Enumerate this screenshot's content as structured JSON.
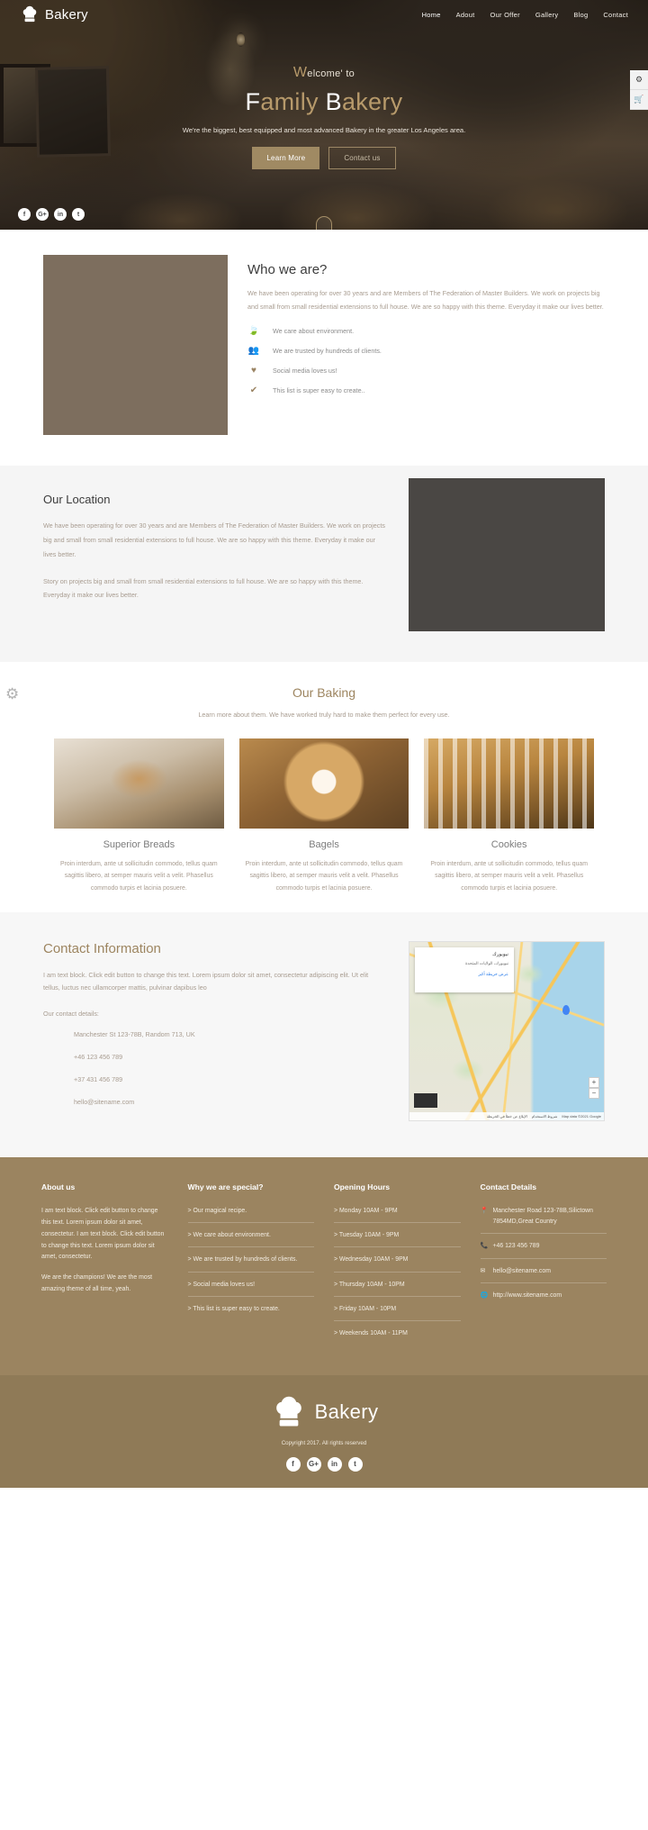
{
  "brand": {
    "name": "Bakery",
    "icon": "chef-hat-icon"
  },
  "nav": {
    "items": [
      {
        "label": "Home",
        "active": true
      },
      {
        "label": "Adout",
        "active": false
      },
      {
        "label": "Our Offer",
        "active": false
      },
      {
        "label": "Gallery",
        "active": false
      },
      {
        "label": "Blog",
        "active": false
      },
      {
        "label": "Contact",
        "active": false
      }
    ]
  },
  "side_tools": [
    {
      "icon": "gear-settings-icon",
      "glyph": "⚙"
    },
    {
      "icon": "shopping-cart-icon",
      "glyph": "🛒"
    }
  ],
  "hero": {
    "welcome_first": "W",
    "welcome_rest": "elcome' to",
    "title_pre": "F",
    "title_mid": "amily ",
    "title_b": "B",
    "title_end": "akery",
    "subtitle": "We're the biggest, best equipped and most advanced Bakery in the greater Los Angeles area.",
    "btn_primary": "Learn More",
    "btn_secondary": "Contact us",
    "social": [
      {
        "name": "facebook-icon",
        "glyph": "f"
      },
      {
        "name": "google-plus-icon",
        "glyph": "G+"
      },
      {
        "name": "linkedin-icon",
        "glyph": "in"
      },
      {
        "name": "twitter-icon",
        "glyph": "t"
      }
    ]
  },
  "who": {
    "title": "Who we are?",
    "paragraph": "We have been operating for over 30 years and are Members of The Federation of Master Builders. We work on projects big and small from small residential extensions to full house. We are so happy with this theme. Everyday it make our lives better.",
    "features": [
      {
        "icon": "leaf-icon",
        "glyph": "🍃",
        "text": "We care about environment."
      },
      {
        "icon": "users-group-icon",
        "glyph": "👥",
        "text": "We are trusted by hundreds of clients."
      },
      {
        "icon": "heart-icon",
        "glyph": "♥",
        "text": "Social media loves us!"
      },
      {
        "icon": "check-icon",
        "glyph": "✔",
        "text": "This list is super easy to create.."
      }
    ]
  },
  "location": {
    "title": "Our Location",
    "paragraph1": "We have been operating for over 30 years and are Members of The Federation of Master Builders. We work on projects big and small from small residential extensions to full house. We are so happy with this theme. Everyday it make our lives better.",
    "paragraph2": "Story on projects big and small from small residential extensions to full house. We are so happy with this theme. Everyday it make our lives better."
  },
  "baking": {
    "title": "Our Baking",
    "subtitle": "Learn more about them. We have worked truly hard to make them perfect for every use.",
    "gear_icon": "gear-icon",
    "cards": [
      {
        "title": "Superior Breads",
        "desc": "Proin interdum, ante ut sollicitudin commodo, tellus quam sagittis libero, at semper mauris velit a velit. Phasellus commodo turpis et lacinia posuere."
      },
      {
        "title": "Bagels",
        "desc": "Proin interdum, ante ut sollicitudin commodo, tellus quam sagittis libero, at semper mauris velit a velit. Phasellus commodo turpis et lacinia posuere."
      },
      {
        "title": "Cookies",
        "desc": "Proin interdum, ante ut sollicitudin commodo, tellus quam sagittis libero, at semper mauris velit a velit. Phasellus commodo turpis et lacinia posuere."
      }
    ]
  },
  "contact": {
    "title": "Contact Information",
    "paragraph": "I am text block. Click edit button to change this text. Lorem ipsum dolor sit amet, consectetur adipiscing elit. Ut elit tellus, luctus nec ullamcorper mattis, pulvinar dapibus leo",
    "details_label": "Our contact details:",
    "details": [
      "Manchester St 123-78B, Random 713, UK",
      "+46 123 456 789",
      "+37 431 456 789",
      "hello@sitename.com"
    ],
    "map": {
      "info_title": "نيويورك",
      "info_sub": "نيويورك، الولايات المتحدة",
      "info_link": "عرض خريطة أكبر",
      "zoom_in": "+",
      "zoom_out": "−",
      "credit": "Map data ©2021 Google",
      "terms": "شروط الاستخدام",
      "report": "الإبلاغ عن خطأ في الخريطة"
    }
  },
  "footer": {
    "about": {
      "title": "About us",
      "p1": "I am text block. Click edit button to change this text. Lorem ipsum dolor sit amet, consectetur. I am text block. Click edit button to change this text. Lorem ipsum dolor sit amet, consectetur.",
      "p2": "We are the champions! We are the most amazing theme of all time, yeah."
    },
    "special": {
      "title": "Why we are special?",
      "items": [
        "> Our magical recipe.",
        "> We care about environment.",
        "> We are trusted by hundreds of clients.",
        "> Social media loves us!",
        "> This list is super easy to create."
      ]
    },
    "hours": {
      "title": "Opening Hours",
      "items": [
        "> Monday 10AM - 9PM",
        "> Tuesday 10AM - 9PM",
        "> Wednesday 10AM - 9PM",
        "> Thursday 10AM - 10PM",
        "> Friday 10AM - 10PM",
        "> Weekends 10AM - 11PM"
      ]
    },
    "details": {
      "title": "Contact Details",
      "items": [
        {
          "icon": "map-pin-icon",
          "glyph": "📍",
          "text": "Manchester Road 123-78B,Silictown 7854MD,Great Country"
        },
        {
          "icon": "phone-icon",
          "glyph": "📞",
          "text": "+46 123 456 789"
        },
        {
          "icon": "envelope-icon",
          "glyph": "✉",
          "text": "hello@sitename.com"
        },
        {
          "icon": "globe-icon",
          "glyph": "🌐",
          "text": "http://www.sitename.com"
        }
      ]
    }
  },
  "footer_bottom": {
    "brand": "Bakery",
    "copyright": "Copyright 2017. All rights reserved",
    "social": [
      {
        "name": "facebook-icon",
        "glyph": "f"
      },
      {
        "name": "google-plus-icon",
        "glyph": "G+"
      },
      {
        "name": "linkedin-icon",
        "glyph": "in"
      },
      {
        "name": "twitter-icon",
        "glyph": "t"
      }
    ]
  }
}
